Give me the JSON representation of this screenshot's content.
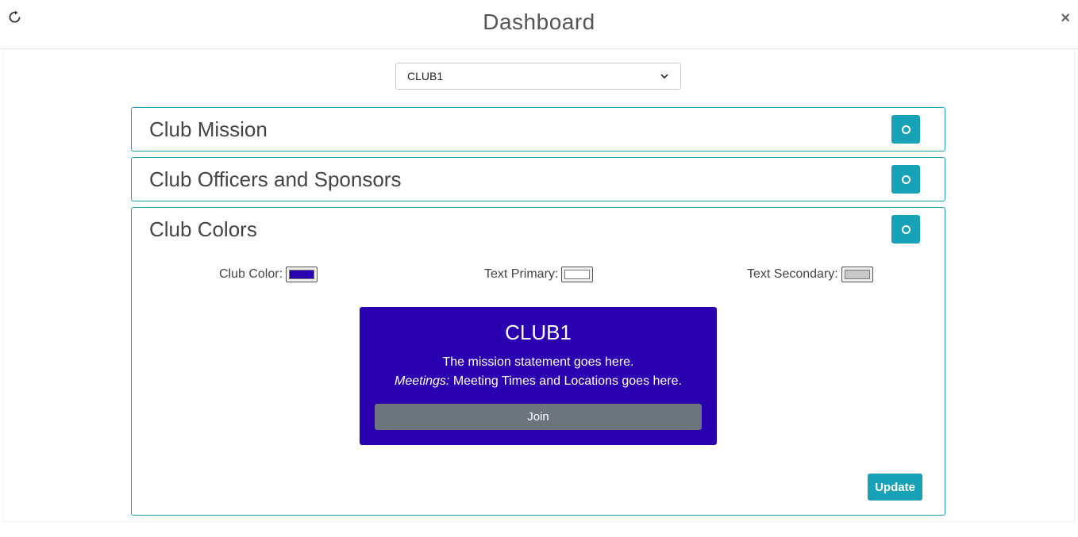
{
  "window": {
    "title": "Dashboard",
    "close_label": "×"
  },
  "icons": {
    "refresh": "refresh-icon",
    "close": "close-icon",
    "toggle": "circle-icon",
    "dropdown": "chevron-down-icon"
  },
  "club_select": {
    "selected": "CLUB1"
  },
  "panels": [
    {
      "title": "Club Mission"
    },
    {
      "title": "Club Officers and Sponsors"
    },
    {
      "title": "Club Colors"
    }
  ],
  "colors": {
    "club_color_label": "Club Color:",
    "club_color": "#2a00b0",
    "text_primary_label": "Text Primary:",
    "text_primary": "#ffffff",
    "text_secondary_label": "Text Secondary:",
    "text_secondary": "#c8c8c8",
    "accent": "#17a2b8",
    "join_button_bg": "#6c757d"
  },
  "preview": {
    "club_name": "CLUB1",
    "mission": "The mission statement goes here.",
    "meetings_label": "Meetings:",
    "meetings_text": " Meeting Times and Locations goes here.",
    "join_label": "Join"
  },
  "actions": {
    "update_label": "Update"
  }
}
